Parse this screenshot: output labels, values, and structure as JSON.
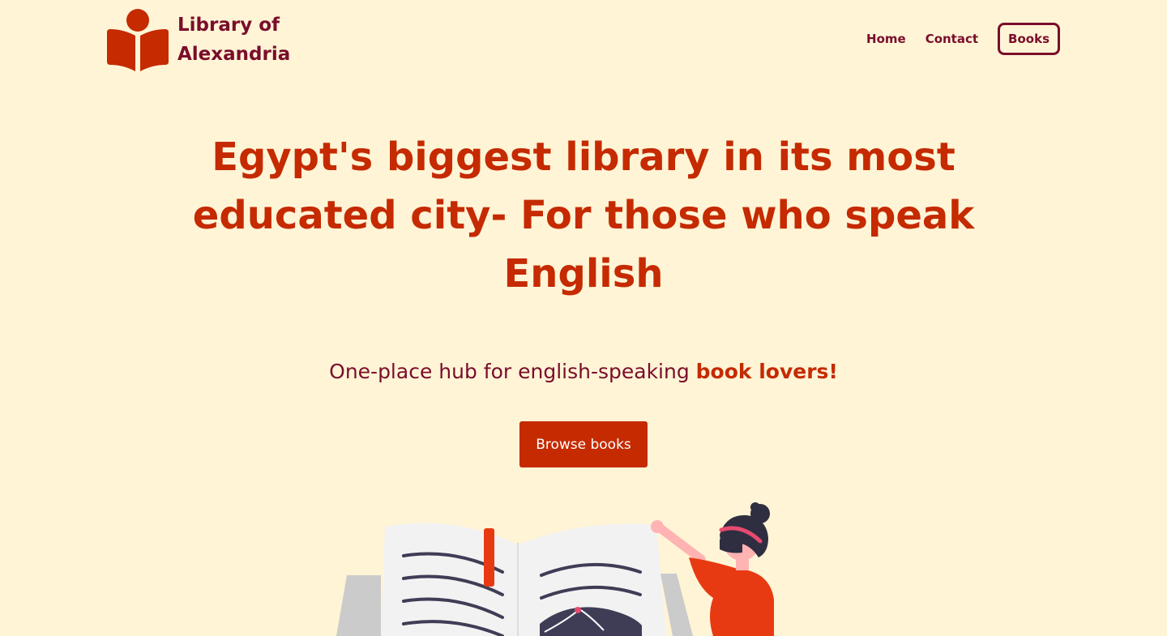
{
  "header": {
    "brand_name": "Library of Alexandria",
    "logo_icon": "book-reader-icon",
    "nav": [
      {
        "label": "Home"
      },
      {
        "label": "Contact"
      },
      {
        "label": "Books"
      }
    ]
  },
  "hero": {
    "headline": "Egypt's biggest library in its most educated city- For those who speak English",
    "tagline_prefix": "One-place hub for english-speaking ",
    "tagline_highlight": "book lovers!",
    "cta_label": "Browse books"
  },
  "illustration": {
    "icon": "reading-woman-open-book-illustration"
  },
  "colors": {
    "background": "#fff4d6",
    "brand": "#7a0d2b",
    "accent": "#c52a00"
  }
}
